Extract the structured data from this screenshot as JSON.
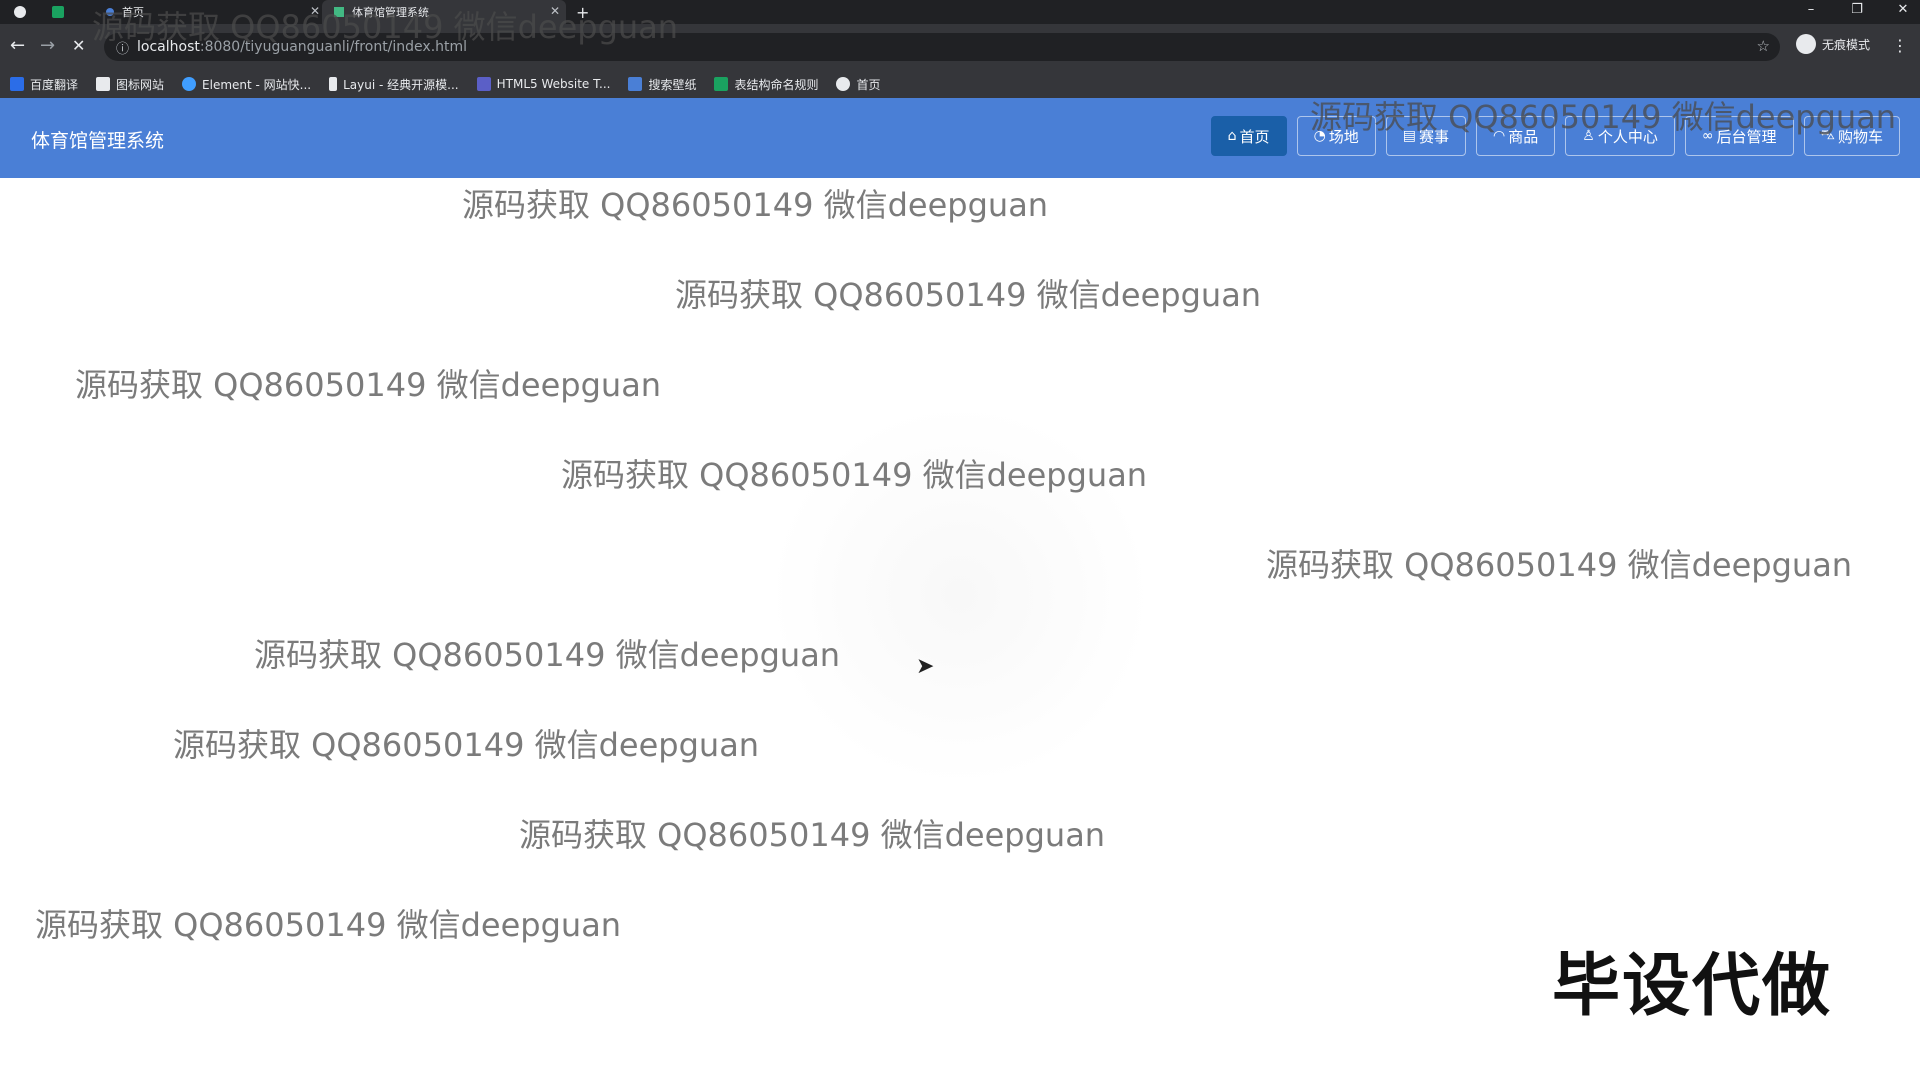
{
  "browser": {
    "tabs": [
      {
        "title": "首页"
      },
      {
        "title": "体育馆管理系统"
      }
    ],
    "new_tab": "+",
    "window": {
      "minimize": "–",
      "restore": "❐",
      "close": "✕"
    },
    "address": {
      "host": "localhost",
      "path": ":8080/tiyuguanguanli/front/index.html"
    },
    "profile_label": "无痕模式",
    "bookmarks": [
      {
        "label": "百度翻译",
        "color": "#2b6de8"
      },
      {
        "label": "图标网站",
        "color": "#e8eaed"
      },
      {
        "label": "Element - 网站快...",
        "color": "#409eff"
      },
      {
        "label": "Layui - 经典开源模...",
        "color": "#e8eaed"
      },
      {
        "label": "HTML5 Website T...",
        "color": "#5b5fc7"
      },
      {
        "label": "搜索壁纸",
        "color": "#4a7fd6"
      },
      {
        "label": "表结构命名规则",
        "color": "#1aa260"
      },
      {
        "label": "首页",
        "color": "#e8eaed"
      }
    ]
  },
  "site": {
    "title": "体育馆管理系统",
    "nav": [
      {
        "label": "首页",
        "icon": "home-icon",
        "glyph": "⌂",
        "active": true
      },
      {
        "label": "场地",
        "icon": "venue-icon",
        "glyph": "◔",
        "active": false
      },
      {
        "label": "赛事",
        "icon": "event-icon",
        "glyph": "▤",
        "active": false
      },
      {
        "label": "商品",
        "icon": "goods-icon",
        "glyph": "◠",
        "active": false
      },
      {
        "label": "个人中心",
        "icon": "user-icon",
        "glyph": "♙",
        "active": false
      },
      {
        "label": "后台管理",
        "icon": "link-icon",
        "glyph": "∞",
        "active": false
      },
      {
        "label": "购物车",
        "icon": "cart-icon",
        "glyph": "⛍",
        "active": false
      }
    ],
    "brand_color": "#4a7fd6",
    "active_nav_color": "#1a5fa8"
  },
  "overlay": {
    "watermark_text": "源码获取 QQ86050149 微信deepguan",
    "corner_text": "毕设代做"
  }
}
